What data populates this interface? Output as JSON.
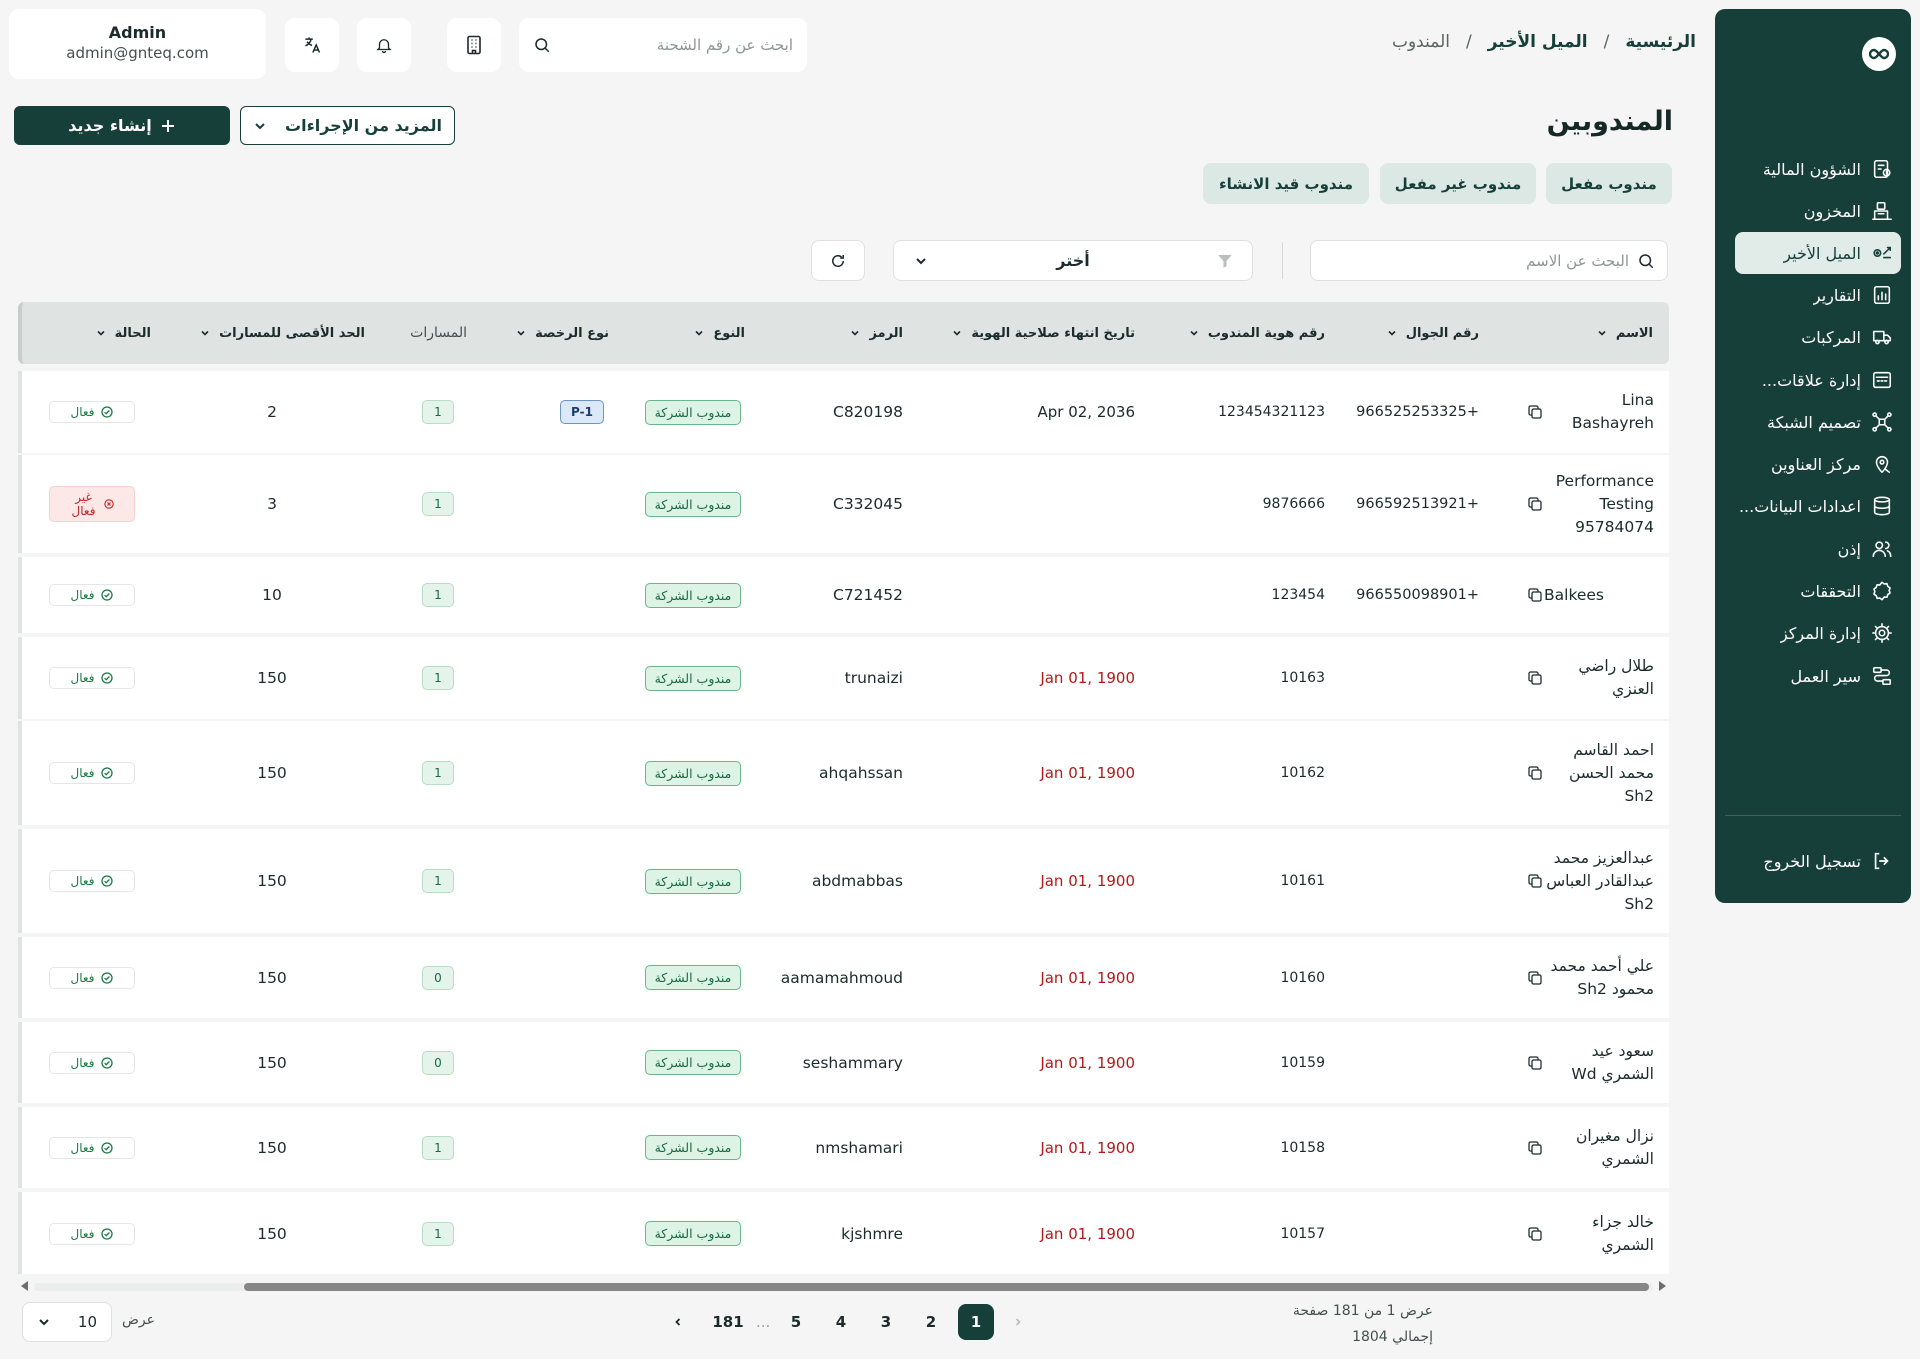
{
  "colors": {
    "brand": "#173f3a",
    "active_status": "#1a7a44",
    "inactive_status": "#c82222",
    "expired_date": "#b31919"
  },
  "user": {
    "name": "Admin",
    "email": "admin@gnteq.com"
  },
  "topbar": {
    "search_placeholder": "ابحث عن رقم الشحنة",
    "icons": [
      "translate-icon",
      "bell-icon",
      "building-icon",
      "search-icon"
    ]
  },
  "breadcrumb": {
    "home": "الرئيسية",
    "section": "الميل الأخير",
    "current": "المندوب",
    "separator": "/"
  },
  "sidebar": {
    "items": [
      {
        "label": "الشؤون المالية",
        "icon": "finance-icon"
      },
      {
        "label": "المخزون",
        "icon": "inventory-icon"
      },
      {
        "label": "الميل الأخير",
        "icon": "last-mile-icon",
        "active": true
      },
      {
        "label": "التقارير",
        "icon": "reports-icon"
      },
      {
        "label": "المركبات",
        "icon": "vehicle-icon"
      },
      {
        "label": "إدارة علاقات...",
        "icon": "crm-icon"
      },
      {
        "label": "تصميم الشبكة",
        "icon": "network-icon"
      },
      {
        "label": "مركز العناوين",
        "icon": "address-icon"
      },
      {
        "label": "اعدادات البيانات...",
        "icon": "database-icon"
      },
      {
        "label": "إذن",
        "icon": "permission-icon"
      },
      {
        "label": "التحققات",
        "icon": "verification-icon"
      },
      {
        "label": "إدارة المركز",
        "icon": "center-settings-icon"
      },
      {
        "label": "سير العمل",
        "icon": "workflow-icon"
      }
    ],
    "logout": "تسجيل الخروج"
  },
  "page": {
    "title": "المندوبين",
    "new_button": "إنشاء جديد",
    "more_actions": "المزيد من الإجراءات"
  },
  "tabs": [
    "مندوب مفعل",
    "مندوب غير مفعل",
    "مندوب قيد الانشاء"
  ],
  "filters": {
    "search_placeholder": "البحث عن الاسم",
    "select_value": "أختر"
  },
  "table": {
    "columns": {
      "name": "الاسم",
      "phone": "رقم الجوال",
      "agent_id": "رقم هوية المندوب",
      "id_expiry": "تاريخ انتهاء صلاحية الهوية",
      "code": "الرمز",
      "type": "النوع",
      "license": "نوع الرخصة",
      "paths": "المسارات",
      "max_paths": "الحد الأقصى للمسارات",
      "status": "الحالة"
    },
    "rows": [
      {
        "name": "Lina Bashayreh",
        "phone": "966525253325+",
        "agent_id": "123454321123",
        "expiry": "Apr 02, 2036",
        "expired": false,
        "code": "C820198",
        "type": "مندوب الشركة",
        "license": "P-1",
        "paths": "1",
        "max": "2",
        "status": "فعال",
        "active": true
      },
      {
        "name": "Performance Testing 95784074",
        "phone": "966592513921+",
        "agent_id": "9876666",
        "expiry": "",
        "expired": false,
        "code": "C332045",
        "type": "مندوب الشركة",
        "license": "",
        "paths": "1",
        "max": "3",
        "status": "غير فعال",
        "active": false
      },
      {
        "name": "Balkees",
        "phone": "966550098901+",
        "agent_id": "123454",
        "expiry": "",
        "expired": false,
        "code": "C721452",
        "type": "مندوب الشركة",
        "license": "",
        "paths": "1",
        "max": "10",
        "status": "فعال",
        "active": true
      },
      {
        "name": "طلال راضي العنزي",
        "phone": "",
        "agent_id": "10163",
        "expiry": "Jan 01, 1900",
        "expired": true,
        "code": "trunaizi",
        "type": "مندوب الشركة",
        "license": "",
        "paths": "1",
        "max": "150",
        "status": "فعال",
        "active": true
      },
      {
        "name": "احمد القاسم محمد الحسن Sh2",
        "phone": "",
        "agent_id": "10162",
        "expiry": "Jan 01, 1900",
        "expired": true,
        "code": "ahqahssan",
        "type": "مندوب الشركة",
        "license": "",
        "paths": "1",
        "max": "150",
        "status": "فعال",
        "active": true
      },
      {
        "name": "عبدالعزيز محمد عبدالقادر العباس Sh2",
        "phone": "",
        "agent_id": "10161",
        "expiry": "Jan 01, 1900",
        "expired": true,
        "code": "abdmabbas",
        "type": "مندوب الشركة",
        "license": "",
        "paths": "1",
        "max": "150",
        "status": "فعال",
        "active": true
      },
      {
        "name": "علي أحمد محمد محمود Sh2",
        "phone": "",
        "agent_id": "10160",
        "expiry": "Jan 01, 1900",
        "expired": true,
        "code": "aamamahmoud",
        "type": "مندوب الشركة",
        "license": "",
        "paths": "0",
        "max": "150",
        "status": "فعال",
        "active": true
      },
      {
        "name": "سعود عيد الشمري Wd",
        "phone": "",
        "agent_id": "10159",
        "expiry": "Jan 01, 1900",
        "expired": true,
        "code": "seshammary",
        "type": "مندوب الشركة",
        "license": "",
        "paths": "0",
        "max": "150",
        "status": "فعال",
        "active": true
      },
      {
        "name": "نزال مغيران الشمري",
        "phone": "",
        "agent_id": "10158",
        "expiry": "Jan 01, 1900",
        "expired": true,
        "code": "nmshamari",
        "type": "مندوب الشركة",
        "license": "",
        "paths": "1",
        "max": "150",
        "status": "فعال",
        "active": true
      },
      {
        "name": "خالد جزاء الشمري",
        "phone": "",
        "agent_id": "10157",
        "expiry": "Jan 01, 1900",
        "expired": true,
        "code": "kjshmre",
        "type": "مندوب الشركة",
        "license": "",
        "paths": "1",
        "max": "150",
        "status": "فعال",
        "active": true
      }
    ]
  },
  "pagination": {
    "pages": [
      "1",
      "2",
      "3",
      "4",
      "5"
    ],
    "ellipsis": "...",
    "last": "181",
    "current": "1",
    "info_line1": "عرض 1 من 181 صفحة",
    "info_line2": "إجمالي 1804",
    "page_size": "10",
    "page_size_label": "عرض"
  }
}
